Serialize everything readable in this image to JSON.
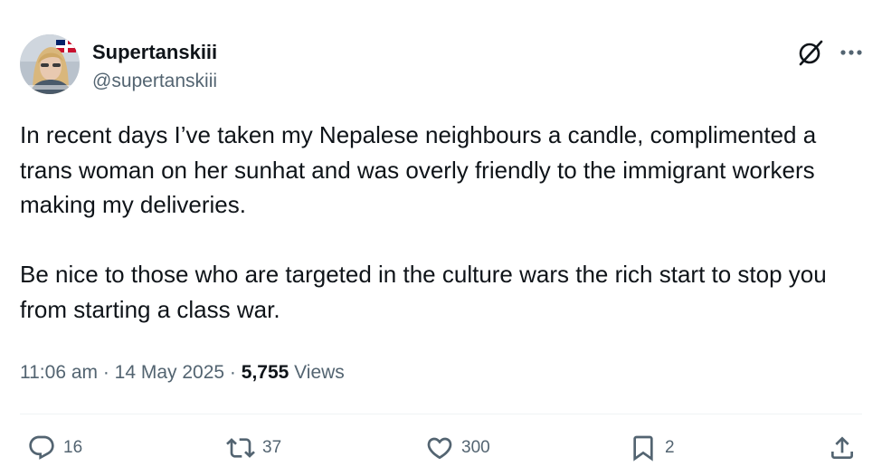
{
  "author": {
    "display_name": "Supertanskiii",
    "handle": "@supertanskiii",
    "avatar_icon": "profile-photo"
  },
  "tweet": {
    "paragraphs": [
      "In recent days I’ve taken my Nepalese neighbours a candle, complimented a trans woman on her sunhat and was overly friendly to the immigrant workers making my deliveries.",
      "Be nice to those who are targeted in the culture wars the rich start to stop you from starting a class war."
    ]
  },
  "meta": {
    "time": "11:06 am",
    "separator": " · ",
    "date": "14 May 2025",
    "views_count": "5,755",
    "views_label": "Views"
  },
  "actions": {
    "replies": "16",
    "reposts": "37",
    "likes": "300",
    "bookmarks": "2"
  },
  "colors": {
    "text": "#0f1419",
    "secondary": "#536471",
    "divider": "#eff3f4"
  }
}
